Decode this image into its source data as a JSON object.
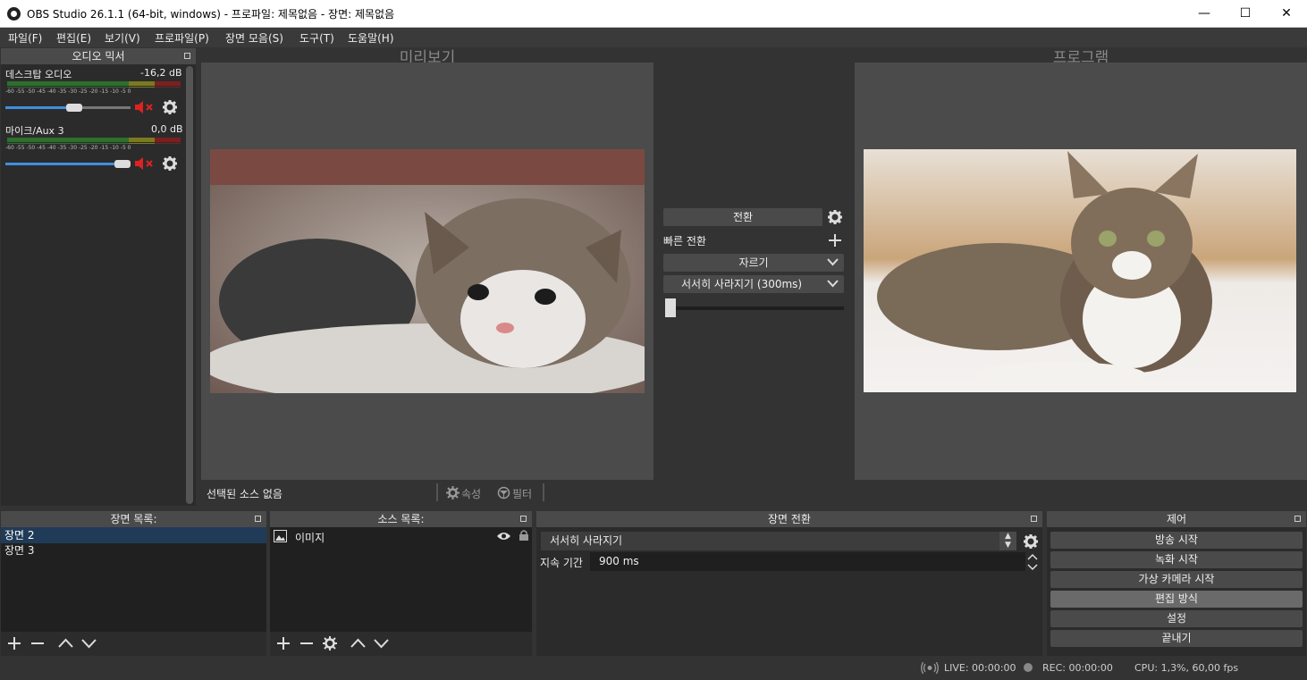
{
  "window": {
    "title": "OBS Studio 26.1.1 (64-bit, windows) - 프로파일: 제목없음 - 장면: 제목없음",
    "minimize": "—",
    "maximize": "☐",
    "close": "✕"
  },
  "menu": [
    "파일(F)",
    "편집(E)",
    "보기(V)",
    "프로파일(P)",
    "장면 모음(S)",
    "도구(T)",
    "도움말(H)"
  ],
  "mixer": {
    "title": "오디오 믹서",
    "ticks": "-60 -55 -50 -45 -40 -35 -30 -25 -20 -15 -10 -5 0",
    "channels": [
      {
        "name": "데스크탑 오디오",
        "db": "-16,2 dB",
        "volume": 0.55
      },
      {
        "name": "마이크/Aux 3",
        "db": "0,0 dB",
        "volume": 1.0
      }
    ]
  },
  "preview": {
    "label": "미리보기",
    "no_source": "선택된 소스 없음",
    "properties": "속성",
    "filters": "필터"
  },
  "program": {
    "label": "프로그램"
  },
  "transition_center": {
    "button": "전환",
    "quick": "빠른 전환",
    "cut": "자르기",
    "fade": "서서히 사라지기 (300ms)"
  },
  "scenes": {
    "title": "장면 목록:",
    "items": [
      "장면 2",
      "장면 3"
    ]
  },
  "sources": {
    "title": "소스 목록:",
    "items": [
      "이미지"
    ]
  },
  "scene_transition": {
    "title": "장면 전환",
    "selected": "서서히 사라지기",
    "duration_label": "지속 기간",
    "duration": "900 ms"
  },
  "controls": {
    "title": "제어",
    "buttons": [
      "방송 시작",
      "녹화 시작",
      "가상 카메라 시작",
      "편집 방식",
      "설정",
      "끝내기"
    ]
  },
  "status": {
    "live": "LIVE: 00:00:00",
    "rec": "REC: 00:00:00",
    "cpu": "CPU: 1,3%, 60,00 fps"
  }
}
